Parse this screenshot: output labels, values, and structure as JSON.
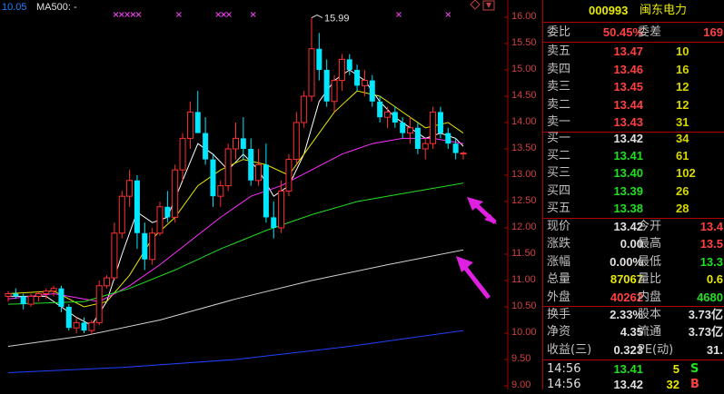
{
  "chart_header": {
    "price_label": "10.05",
    "ma_label": "MA500: -"
  },
  "peak_label": "15.99",
  "y_axis": {
    "ticks": [
      "16.00",
      "15.50",
      "15.00",
      "14.50",
      "14.00",
      "13.50",
      "13.00",
      "12.50",
      "12.00",
      "11.50",
      "11.00",
      "10.50",
      "10.00",
      "9.50",
      "9.00"
    ]
  },
  "colors": {
    "up": "#ff3030",
    "down": "#00e8ff",
    "ma5": "#ffffff",
    "ma10": "#e8e800",
    "ma20": "#ff30ff",
    "ma60": "#20e020",
    "ma120": "#d0d0d0",
    "ma250": "#2040ff",
    "arrow": "#e020e0"
  },
  "chart_data": {
    "type": "candlestick",
    "ylim": [
      9.0,
      16.12
    ],
    "candles": [
      [
        10.7,
        10.8,
        10.6,
        10.75
      ],
      [
        10.75,
        10.85,
        10.65,
        10.7
      ],
      [
        10.7,
        10.75,
        10.45,
        10.55
      ],
      [
        10.55,
        10.75,
        10.5,
        10.7
      ],
      [
        10.7,
        10.8,
        10.6,
        10.75
      ],
      [
        10.75,
        10.85,
        10.65,
        10.8
      ],
      [
        10.8,
        10.9,
        10.7,
        10.85
      ],
      [
        10.85,
        10.9,
        10.4,
        10.5
      ],
      [
        10.5,
        10.55,
        10.05,
        10.1
      ],
      [
        10.1,
        10.3,
        10.0,
        10.2
      ],
      [
        10.2,
        10.3,
        10.0,
        10.05
      ],
      [
        10.05,
        10.25,
        9.98,
        10.2
      ],
      [
        10.2,
        11.0,
        10.15,
        10.9
      ],
      [
        10.9,
        11.1,
        10.85,
        11.05
      ],
      [
        11.05,
        12.1,
        11.0,
        11.9
      ],
      [
        11.9,
        12.7,
        11.8,
        12.6
      ],
      [
        12.6,
        13.1,
        12.4,
        12.9
      ],
      [
        12.9,
        13.0,
        11.6,
        11.9
      ],
      [
        11.9,
        12.1,
        11.2,
        11.4
      ],
      [
        11.4,
        12.0,
        11.3,
        11.9
      ],
      [
        11.9,
        12.5,
        11.85,
        12.4
      ],
      [
        12.4,
        12.7,
        12.1,
        12.2
      ],
      [
        12.2,
        13.2,
        12.1,
        13.1
      ],
      [
        13.1,
        13.8,
        12.9,
        13.7
      ],
      [
        13.7,
        14.4,
        13.5,
        14.2
      ],
      [
        14.2,
        14.6,
        13.9,
        13.8
      ],
      [
        13.8,
        14.1,
        13.2,
        13.3
      ],
      [
        13.3,
        13.4,
        12.4,
        12.6
      ],
      [
        12.6,
        12.9,
        12.4,
        12.8
      ],
      [
        12.8,
        13.6,
        12.7,
        13.5
      ],
      [
        13.5,
        14.0,
        13.3,
        13.7
      ],
      [
        13.7,
        14.1,
        13.3,
        13.5
      ],
      [
        13.5,
        13.7,
        12.8,
        12.9
      ],
      [
        12.9,
        13.5,
        12.8,
        13.2
      ],
      [
        13.2,
        13.6,
        12.1,
        12.2
      ],
      [
        12.2,
        12.5,
        11.8,
        12.0
      ],
      [
        12.0,
        12.9,
        11.9,
        12.7
      ],
      [
        12.7,
        13.4,
        12.6,
        13.3
      ],
      [
        13.3,
        14.2,
        13.2,
        14.0
      ],
      [
        14.0,
        14.6,
        13.9,
        14.5
      ],
      [
        14.5,
        15.99,
        14.4,
        15.4
      ],
      [
        15.4,
        15.7,
        14.8,
        15.0
      ],
      [
        15.0,
        15.2,
        14.3,
        14.4
      ],
      [
        14.4,
        14.9,
        14.2,
        14.8
      ],
      [
        14.8,
        15.3,
        14.6,
        15.2
      ],
      [
        15.2,
        15.3,
        14.9,
        15.0
      ],
      [
        15.0,
        15.1,
        14.6,
        14.7
      ],
      [
        14.7,
        15.0,
        14.5,
        14.8
      ],
      [
        14.8,
        14.9,
        14.3,
        14.4
      ],
      [
        14.4,
        14.5,
        14.0,
        14.1
      ],
      [
        14.1,
        14.3,
        13.9,
        14.2
      ],
      [
        14.2,
        14.3,
        13.9,
        14.0
      ],
      [
        14.0,
        14.1,
        13.7,
        13.8
      ],
      [
        13.8,
        14.1,
        13.6,
        13.9
      ],
      [
        13.9,
        14.0,
        13.4,
        13.5
      ],
      [
        13.5,
        13.7,
        13.3,
        13.6
      ],
      [
        13.6,
        14.3,
        13.5,
        14.2
      ],
      [
        14.2,
        14.3,
        13.7,
        13.8
      ],
      [
        13.8,
        13.9,
        13.5,
        13.6
      ],
      [
        13.6,
        13.7,
        13.3,
        13.42
      ],
      [
        13.42,
        13.45,
        13.3,
        13.42
      ]
    ],
    "ma_lines": {
      "ma5": [
        [
          0,
          10.7
        ],
        [
          5,
          10.7
        ],
        [
          9,
          10.3
        ],
        [
          11,
          10.15
        ],
        [
          13,
          10.6
        ],
        [
          15,
          11.5
        ],
        [
          17,
          12.3
        ],
        [
          19,
          12.1
        ],
        [
          21,
          12.2
        ],
        [
          23,
          12.9
        ],
        [
          25,
          13.6
        ],
        [
          27,
          13.4
        ],
        [
          29,
          13.1
        ],
        [
          31,
          13.4
        ],
        [
          33,
          13.1
        ],
        [
          35,
          12.6
        ],
        [
          37,
          12.8
        ],
        [
          39,
          13.4
        ],
        [
          41,
          14.4
        ],
        [
          43,
          14.8
        ],
        [
          45,
          15.0
        ],
        [
          47,
          14.8
        ],
        [
          49,
          14.4
        ],
        [
          51,
          14.1
        ],
        [
          53,
          13.9
        ],
        [
          55,
          13.7
        ],
        [
          57,
          13.8
        ],
        [
          59,
          13.7
        ],
        [
          60,
          13.55
        ]
      ],
      "ma10": [
        [
          0,
          10.75
        ],
        [
          6,
          10.8
        ],
        [
          10,
          10.5
        ],
        [
          13,
          10.6
        ],
        [
          16,
          11.1
        ],
        [
          19,
          11.8
        ],
        [
          22,
          12.2
        ],
        [
          25,
          12.8
        ],
        [
          28,
          13.1
        ],
        [
          31,
          13.3
        ],
        [
          34,
          13.2
        ],
        [
          37,
          13.0
        ],
        [
          40,
          13.6
        ],
        [
          43,
          14.2
        ],
        [
          46,
          14.6
        ],
        [
          49,
          14.5
        ],
        [
          52,
          14.2
        ],
        [
          55,
          13.9
        ],
        [
          58,
          14.0
        ],
        [
          60,
          13.8
        ]
      ],
      "ma20": [
        [
          0,
          10.65
        ],
        [
          6,
          10.75
        ],
        [
          12,
          10.6
        ],
        [
          16,
          10.9
        ],
        [
          20,
          11.3
        ],
        [
          24,
          11.75
        ],
        [
          28,
          12.2
        ],
        [
          32,
          12.6
        ],
        [
          36,
          12.8
        ],
        [
          40,
          13.1
        ],
        [
          44,
          13.4
        ],
        [
          48,
          13.6
        ],
        [
          52,
          13.7
        ],
        [
          56,
          13.7
        ],
        [
          60,
          13.6
        ]
      ],
      "ma60": [
        [
          0,
          10.55
        ],
        [
          10,
          10.6
        ],
        [
          16,
          10.85
        ],
        [
          22,
          11.2
        ],
        [
          28,
          11.6
        ],
        [
          34,
          11.95
        ],
        [
          40,
          12.25
        ],
        [
          46,
          12.5
        ],
        [
          52,
          12.65
        ],
        [
          60,
          12.85
        ]
      ],
      "ma120": [
        [
          0,
          9.75
        ],
        [
          10,
          9.95
        ],
        [
          20,
          10.25
        ],
        [
          30,
          10.65
        ],
        [
          40,
          11.0
        ],
        [
          50,
          11.3
        ],
        [
          60,
          11.58
        ]
      ],
      "ma250": [
        [
          0,
          9.25
        ],
        [
          15,
          9.35
        ],
        [
          30,
          9.5
        ],
        [
          45,
          9.75
        ],
        [
          60,
          10.05
        ]
      ]
    }
  },
  "panel": {
    "code": "000993",
    "name": "闽东电力",
    "weibi": {
      "label": "委比",
      "value": "50.45%",
      "label2": "委差",
      "value2": "169"
    },
    "sells": [
      {
        "label": "卖五",
        "price": "13.47",
        "vol": "10"
      },
      {
        "label": "卖四",
        "price": "13.46",
        "vol": "16"
      },
      {
        "label": "卖三",
        "price": "13.45",
        "vol": "12"
      },
      {
        "label": "卖二",
        "price": "13.44",
        "vol": "12"
      },
      {
        "label": "卖一",
        "price": "13.43",
        "vol": "31"
      }
    ],
    "buys": [
      {
        "label": "买一",
        "price": "13.42",
        "vol": "34"
      },
      {
        "label": "买二",
        "price": "13.41",
        "vol": "61"
      },
      {
        "label": "买三",
        "price": "13.40",
        "vol": "102"
      },
      {
        "label": "买四",
        "price": "13.39",
        "vol": "26"
      },
      {
        "label": "买五",
        "price": "13.38",
        "vol": "28"
      }
    ],
    "stats": [
      {
        "l1": "现价",
        "v1": "13.42",
        "c1": "white",
        "l2": "今开",
        "v2": "13.4",
        "c2": "red"
      },
      {
        "l1": "涨跌",
        "v1": "0.00",
        "c1": "white",
        "l2": "最高",
        "v2": "13.5",
        "c2": "red"
      },
      {
        "l1": "涨幅",
        "v1": "0.00%",
        "c1": "white",
        "l2": "最低",
        "v2": "13.3",
        "c2": "green"
      },
      {
        "l1": "总量",
        "v1": "87067",
        "c1": "yellow",
        "l2": "量比",
        "v2": "0.6",
        "c2": "yellow"
      },
      {
        "l1": "外盘",
        "v1": "40262",
        "c1": "red",
        "l2": "内盘",
        "v2": "4680",
        "c2": "green"
      }
    ],
    "stats2": [
      {
        "l1": "换手",
        "v1": "2.33%",
        "l2": "股本",
        "v2": "3.73亿"
      },
      {
        "l1": "净资",
        "v1": "4.35",
        "l2": "流通",
        "v2": "3.73亿"
      },
      {
        "l1": "收益(三)",
        "v1": "0.323",
        "l2": "PE(动)",
        "v2": "31."
      }
    ],
    "ticks": [
      {
        "time": "14:56",
        "price": "13.41",
        "vol": "5",
        "dir": "S",
        "pc": "green",
        "dc": "green"
      },
      {
        "time": "14:56",
        "price": "13.42",
        "vol": "32",
        "dir": "B",
        "pc": "white",
        "dc": "red"
      }
    ]
  }
}
